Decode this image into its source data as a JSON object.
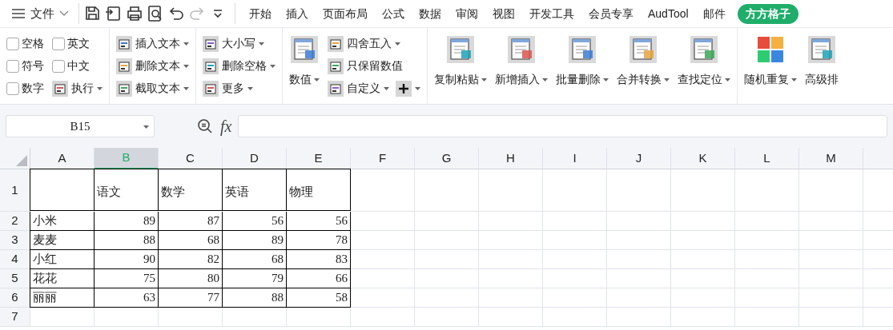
{
  "menu": {
    "file_label": "文件"
  },
  "tabs": [
    {
      "label": "开始",
      "selected": false
    },
    {
      "label": "插入",
      "selected": false
    },
    {
      "label": "页面布局",
      "selected": false
    },
    {
      "label": "公式",
      "selected": false
    },
    {
      "label": "数据",
      "selected": false
    },
    {
      "label": "审阅",
      "selected": false
    },
    {
      "label": "视图",
      "selected": false
    },
    {
      "label": "开发工具",
      "selected": false
    },
    {
      "label": "会员专享",
      "selected": false
    },
    {
      "label": "AudTool",
      "selected": false
    },
    {
      "label": "邮件",
      "selected": false
    },
    {
      "label": "方方格子",
      "selected": true
    }
  ],
  "ribbon": {
    "groups": [
      {
        "items": [
          {
            "kind": "checkbox",
            "label": "空格",
            "checked": false
          },
          {
            "kind": "checkbox",
            "label": "符号",
            "checked": false
          },
          {
            "kind": "checkbox",
            "label": "数字",
            "checked": false
          },
          {
            "kind": "checkbox",
            "label": "英文",
            "checked": false
          },
          {
            "kind": "checkbox",
            "label": "中文",
            "checked": false
          },
          {
            "kind": "small",
            "label": "执行",
            "dropdown": true
          }
        ]
      },
      {
        "items": [
          {
            "kind": "small",
            "label": "插入文本",
            "dropdown": true
          },
          {
            "kind": "small",
            "label": "删除文本",
            "dropdown": true
          },
          {
            "kind": "small",
            "label": "截取文本",
            "dropdown": true
          }
        ]
      },
      {
        "items": [
          {
            "kind": "small",
            "label": "大小写",
            "dropdown": true
          },
          {
            "kind": "small",
            "label": "删除空格",
            "dropdown": true
          },
          {
            "kind": "small",
            "label": "更多",
            "dropdown": true
          }
        ]
      },
      {
        "items": [
          {
            "kind": "large",
            "label": "数值",
            "dropdown": true
          },
          {
            "kind": "small",
            "label": "四舍五入",
            "dropdown": true
          },
          {
            "kind": "small",
            "label": "只保留数值",
            "dropdown": false
          },
          {
            "kind": "small",
            "label": "自定义",
            "dropdown": true,
            "plus_button": true
          }
        ]
      },
      {
        "items": [
          {
            "kind": "large",
            "label": "复制粘贴",
            "dropdown": true
          },
          {
            "kind": "large",
            "label": "新增插入",
            "dropdown": true
          },
          {
            "kind": "large",
            "label": "批量删除",
            "dropdown": true
          },
          {
            "kind": "large",
            "label": "合并转换",
            "dropdown": true
          },
          {
            "kind": "large",
            "label": "查找定位",
            "dropdown": true
          }
        ]
      },
      {
        "items": [
          {
            "kind": "large",
            "label": "随机重复",
            "dropdown": true
          },
          {
            "kind": "large",
            "label": "高级排",
            "dropdown": false
          }
        ]
      }
    ]
  },
  "formula_bar": {
    "name_box": "B15",
    "fx": "fx"
  },
  "sheet": {
    "columns": [
      {
        "label": "A",
        "selected": false
      },
      {
        "label": "B",
        "selected": true
      },
      {
        "label": "C",
        "selected": false
      },
      {
        "label": "D",
        "selected": false
      },
      {
        "label": "E",
        "selected": false
      },
      {
        "label": "F",
        "selected": false
      },
      {
        "label": "G",
        "selected": false
      },
      {
        "label": "H",
        "selected": false
      },
      {
        "label": "I",
        "selected": false
      },
      {
        "label": "J",
        "selected": false
      },
      {
        "label": "K",
        "selected": false
      },
      {
        "label": "L",
        "selected": false
      },
      {
        "label": "M",
        "selected": false
      }
    ],
    "rows": [
      {
        "label": "1",
        "cells": [
          "",
          "语文",
          "数学",
          "英语",
          "物理"
        ]
      },
      {
        "label": "2",
        "cells": [
          "小米",
          "89",
          "87",
          "56",
          "56"
        ]
      },
      {
        "label": "3",
        "cells": [
          "麦麦",
          "88",
          "68",
          "89",
          "78"
        ]
      },
      {
        "label": "4",
        "cells": [
          "小红",
          "90",
          "82",
          "68",
          "83"
        ]
      },
      {
        "label": "5",
        "cells": [
          "花花",
          "75",
          "80",
          "79",
          "66"
        ]
      },
      {
        "label": "6",
        "cells": [
          "丽丽",
          "63",
          "77",
          "88",
          "58"
        ]
      },
      {
        "label": "7",
        "cells": []
      }
    ]
  }
}
